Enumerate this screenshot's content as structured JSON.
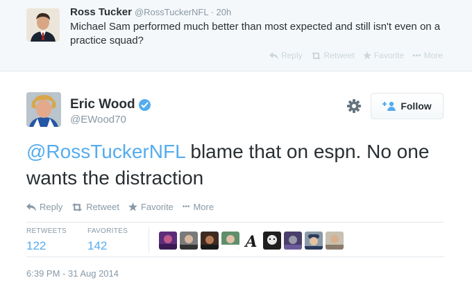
{
  "parent_tweet": {
    "name": "Ross Tucker",
    "handle": "@RossTuckerNFL",
    "time": "· 20h",
    "text": "Michael Sam performed much better than most expected and still isn't even on a practice squad?",
    "actions": {
      "reply": "Reply",
      "retweet": "Retweet",
      "favorite": "Favorite",
      "more": "More"
    }
  },
  "main_tweet": {
    "name": "Eric Wood",
    "handle": "@EWood70",
    "follow_label": "Follow",
    "mention": "@RossTuckerNFL",
    "text": " blame that on espn. No one wants the distraction",
    "actions": {
      "reply": "Reply",
      "retweet": "Retweet",
      "favorite": "Favorite",
      "more": "More"
    },
    "stats": {
      "retweets_label": "RETWEETS",
      "retweets": "122",
      "favorites_label": "FAVORITES",
      "favorites": "142"
    },
    "timestamp": "6:39 PM - 31 Aug 2014"
  },
  "favoriters": [
    {
      "icon": "avatar-purple"
    },
    {
      "icon": "avatar-gray"
    },
    {
      "icon": "avatar-dark"
    },
    {
      "icon": "avatar-green"
    },
    {
      "icon": "atlanta-a-logo"
    },
    {
      "icon": "avatar-bw"
    },
    {
      "icon": "avatar-purple-bw"
    },
    {
      "icon": "avatar-cap"
    },
    {
      "icon": "avatar-light"
    }
  ],
  "colors": {
    "accent": "#55acee",
    "muted": "#8899a6",
    "text": "#292f33",
    "border": "#e1e8ed"
  }
}
